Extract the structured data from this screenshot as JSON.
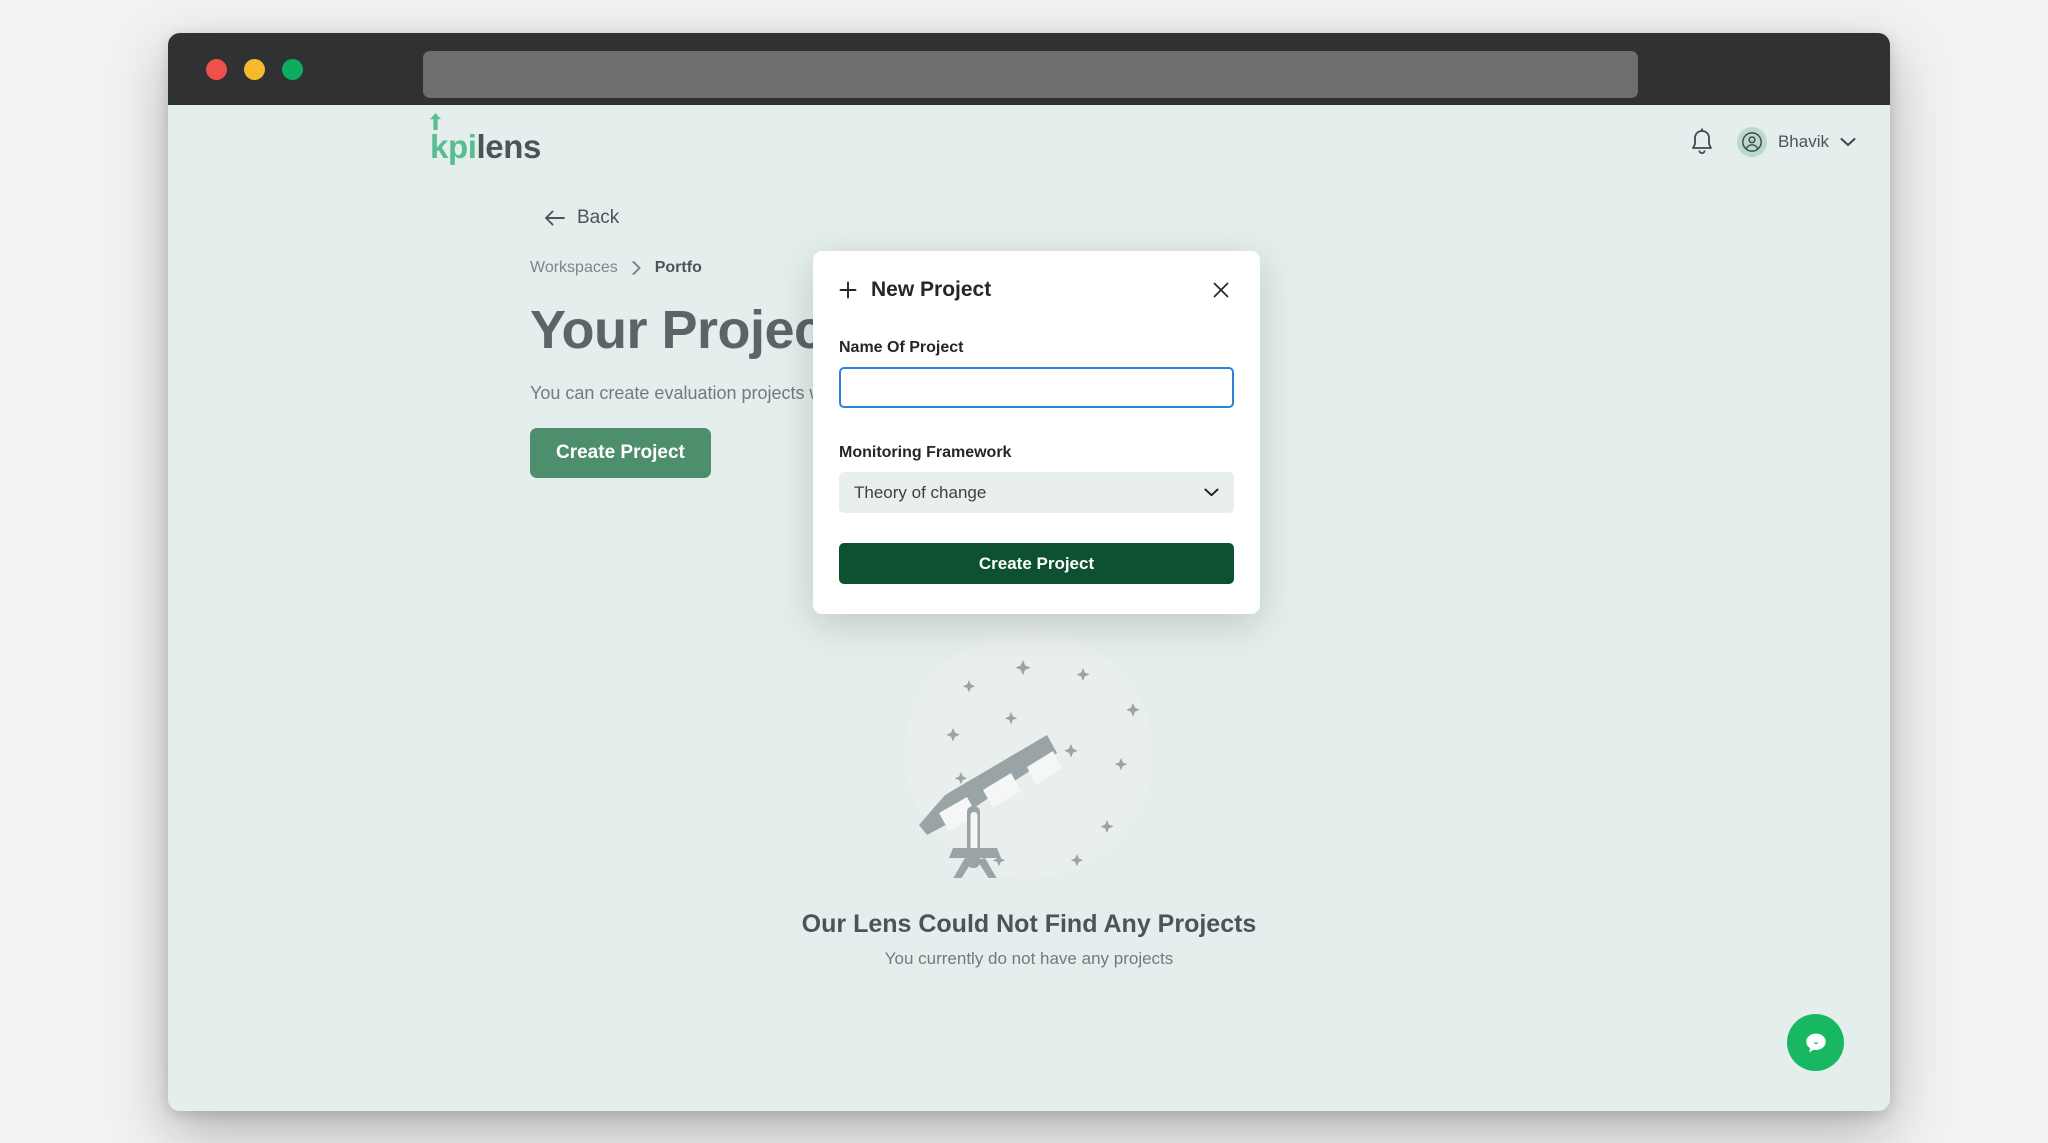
{
  "browser": {
    "traffic_lights": [
      "close",
      "minimize",
      "maximize"
    ],
    "url_value": ""
  },
  "header": {
    "logo_first": "kpi",
    "logo_second": "lens",
    "notifications_icon": "bell-icon",
    "user_name": "Bhavik",
    "user_menu_icon": "chevron-down-icon"
  },
  "nav": {
    "back_label": "Back",
    "breadcrumb": [
      {
        "label": "Workspaces",
        "current": false
      },
      {
        "label": "Portfo",
        "current": true
      }
    ]
  },
  "main": {
    "title": "Your Projects",
    "description": "You can create evaluation projects within your workspace",
    "create_button": "Create Project"
  },
  "empty_state": {
    "illustration": "telescope-illustration",
    "title": "Our Lens Could Not Find Any Projects",
    "subtitle": "You currently do not have any projects"
  },
  "modal": {
    "title": "New Project",
    "add_icon": "plus-icon",
    "close_icon": "close-icon",
    "name_label": "Name Of Project",
    "name_value": "",
    "name_placeholder": "",
    "framework_label": "Monitoring Framework",
    "framework_value": "Theory of change",
    "framework_options": [
      "Theory of change"
    ],
    "submit_label": "Create Project"
  },
  "chat": {
    "icon": "chat-bubble-icon"
  },
  "colors": {
    "page_background": "#e4eeec",
    "brand_green": "#58be8f",
    "button_green": "#4d8e6c",
    "modal_button_green": "#0d5130",
    "input_focus_blue": "#2c82d8",
    "chat_green": "#18b863",
    "text_dark": "#4b5457"
  }
}
